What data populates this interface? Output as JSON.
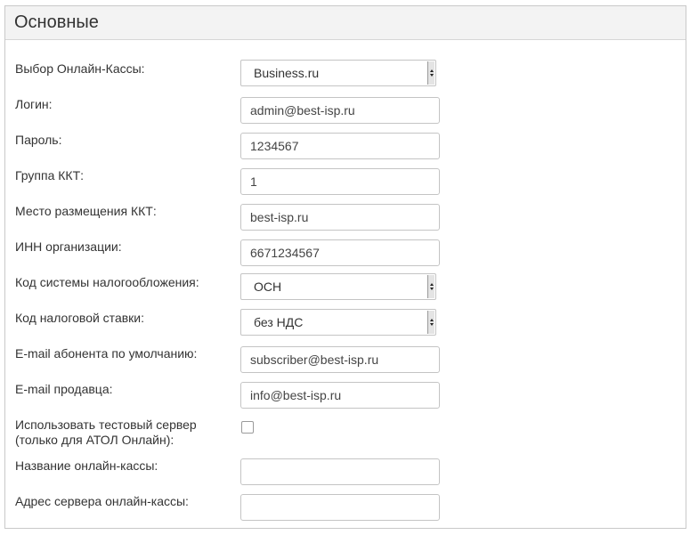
{
  "header": {
    "title": "Основные"
  },
  "form": {
    "online_kassa": {
      "label": "Выбор Онлайн-Кассы:",
      "value": "Business.ru"
    },
    "login": {
      "label": "Логин:",
      "value": "admin@best-isp.ru"
    },
    "password": {
      "label": "Пароль:",
      "value": "1234567"
    },
    "kkt_group": {
      "label": "Группа ККТ:",
      "value": "1"
    },
    "kkt_location": {
      "label": "Место размещения ККТ:",
      "value": "best-isp.ru"
    },
    "inn": {
      "label": "ИНН организации:",
      "value": "6671234567"
    },
    "tax_system": {
      "label": "Код системы налогообложения:",
      "value": "ОСН"
    },
    "tax_rate": {
      "label": "Код налоговой ставки:",
      "value": "без НДС"
    },
    "subscriber_email": {
      "label": "E-mail абонента по умолчанию:",
      "value": "subscriber@best-isp.ru"
    },
    "seller_email": {
      "label": "E-mail продавца:",
      "value": "info@best-isp.ru"
    },
    "test_server": {
      "label_line1": "Использовать тестовый сервер",
      "label_line2": "(только для АТОЛ Онлайн):",
      "checked": false
    },
    "kassa_name": {
      "label": "Название онлайн-кассы:",
      "value": ""
    },
    "server_address": {
      "label": "Адрес сервера онлайн-кассы:",
      "value": ""
    }
  }
}
